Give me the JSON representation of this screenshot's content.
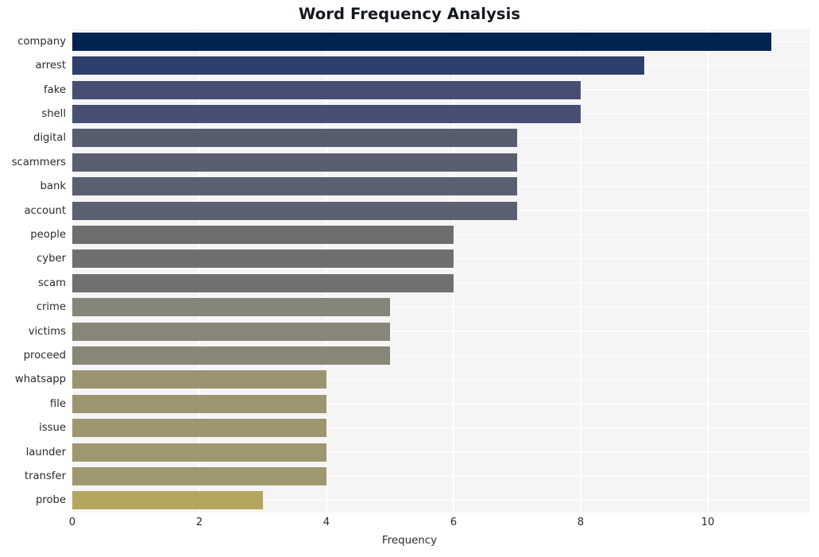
{
  "chart_data": {
    "type": "bar",
    "orientation": "horizontal",
    "title": "Word Frequency Analysis",
    "xlabel": "Frequency",
    "ylabel": "",
    "categories": [
      "company",
      "arrest",
      "fake",
      "shell",
      "digital",
      "scammers",
      "bank",
      "account",
      "people",
      "cyber",
      "scam",
      "crime",
      "victims",
      "proceed",
      "whatsapp",
      "file",
      "issue",
      "launder",
      "transfer",
      "probe"
    ],
    "values": [
      11,
      9,
      8,
      8,
      7,
      7,
      7,
      7,
      6,
      6,
      6,
      5,
      5,
      5,
      4,
      4,
      4,
      4,
      4,
      3
    ],
    "xlim": [
      0,
      11.6
    ],
    "xticks": [
      0,
      2,
      4,
      6,
      8,
      10
    ],
    "xtick_labels": [
      "0",
      "2",
      "4",
      "6",
      "8",
      "10"
    ],
    "grid": true,
    "grid_color": "#ffffff",
    "plot_background": "#f5f5f6",
    "figure_background": "#ffffff",
    "legend": null,
    "bar_colors": [
      "#00234f",
      "#2e3f6b",
      "#464f71",
      "#474f72",
      "#585d6e",
      "#5a5f70",
      "#5b6071",
      "#5c6172",
      "#6d6e70",
      "#6e6f71",
      "#6f7071",
      "#86857a",
      "#878678",
      "#888777",
      "#9b9470",
      "#9c9570",
      "#9d966f",
      "#9e976f",
      "#9f986e",
      "#b3a75f"
    ]
  },
  "axis": {
    "x_title": "Frequency"
  }
}
